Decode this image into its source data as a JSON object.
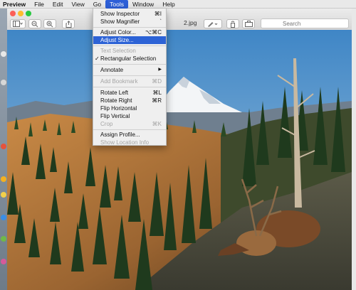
{
  "menubar": {
    "items": [
      "Preview",
      "File",
      "Edit",
      "View",
      "Go",
      "Tools",
      "Window",
      "Help"
    ],
    "active": "Tools"
  },
  "window": {
    "title": "2.jpg",
    "search_placeholder": "Search"
  },
  "tools_menu": {
    "items": [
      {
        "label": "Show Inspector",
        "shortcut": "⌘I",
        "enabled": true
      },
      {
        "label": "Show Magnifier",
        "shortcut": "`",
        "enabled": true
      },
      {
        "label": "Adjust Color...",
        "shortcut": "⌥⌘C",
        "enabled": true
      },
      {
        "label": "Adjust Size...",
        "shortcut": "",
        "enabled": true,
        "highlighted": true
      },
      {
        "label": "Text Selection",
        "shortcut": "",
        "enabled": false
      },
      {
        "label": "Rectangular Selection",
        "shortcut": "",
        "enabled": true,
        "checked": true
      },
      {
        "label": "Annotate",
        "shortcut": "",
        "enabled": true,
        "submenu": true
      },
      {
        "label": "Add Bookmark",
        "shortcut": "⌘D",
        "enabled": false
      },
      {
        "label": "Rotate Left",
        "shortcut": "⌘L",
        "enabled": true
      },
      {
        "label": "Rotate Right",
        "shortcut": "⌘R",
        "enabled": true
      },
      {
        "label": "Flip Horizontal",
        "shortcut": "",
        "enabled": true
      },
      {
        "label": "Flip Vertical",
        "shortcut": "",
        "enabled": true
      },
      {
        "label": "Crop",
        "shortcut": "⌘K",
        "enabled": false
      },
      {
        "label": "Assign Profile...",
        "shortcut": "",
        "enabled": true
      },
      {
        "label": "Show Location Info",
        "shortcut": "",
        "enabled": false
      }
    ]
  },
  "icons": {
    "check": "✓",
    "submenu_arrow": "▶"
  },
  "colors": {
    "menu_highlight": "#2d63d6",
    "close": "#fc5f57",
    "minimize": "#fdbc2e",
    "zoom": "#28c840"
  }
}
